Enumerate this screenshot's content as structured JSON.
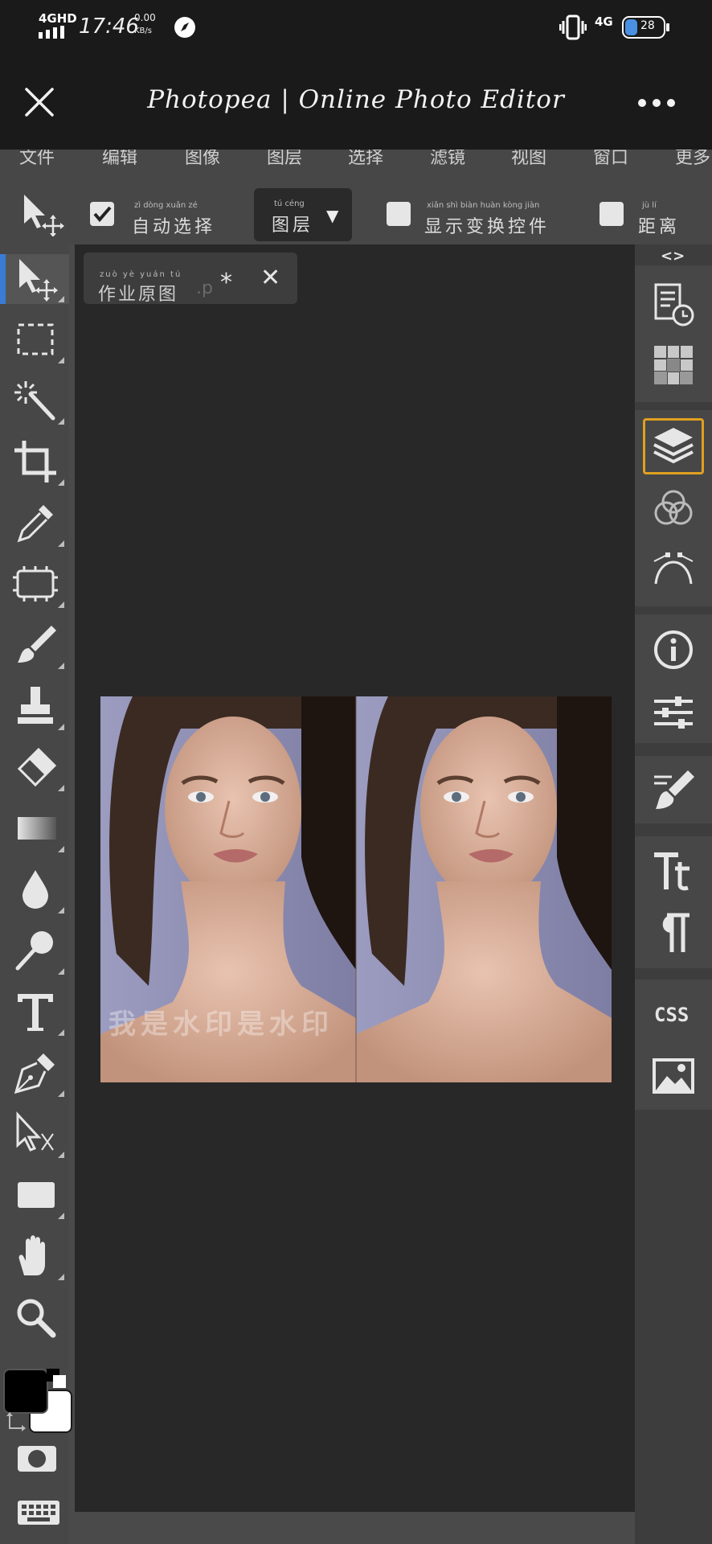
{
  "status_bar": {
    "network": "4GHD",
    "time": "17:46",
    "speed_value": "0.00",
    "speed_unit": "KB/s",
    "network_right": "4G",
    "battery": "28"
  },
  "title_bar": {
    "title": "Photopea | Online Photo Editor"
  },
  "menu": {
    "items": [
      "文件",
      "编辑",
      "图像",
      "图层",
      "选择",
      "滤镜",
      "视图",
      "窗口",
      "更多"
    ]
  },
  "options": {
    "auto_select": {
      "label": "自动选择",
      "pinyin": "zì dòng xuǎn zé",
      "checked": true
    },
    "layer_dropdown": {
      "label": "图层",
      "pinyin": "tú céng",
      "arrow": "▼"
    },
    "show_transform": {
      "label": "显示变换控件",
      "pinyin": "xiǎn shì biàn huàn kòng jiàn",
      "checked": false
    },
    "distance": {
      "label": "距离",
      "pinyin": "jù lí",
      "checked": false
    }
  },
  "document_tab": {
    "name": "作业原图",
    "pinyin": "zuò yè yuán tú",
    "ext_fade": ".p",
    "modified": "*",
    "close": "✕"
  },
  "right_panel": {
    "toggle": "<>",
    "css_label": "CSS"
  },
  "photo": {
    "watermark": "我是水印是水印"
  },
  "colors": {
    "foreground": "#000000",
    "background": "#ffffff",
    "active_panel_border": "#e0a020",
    "active_tool_marker": "#3a7bd5"
  }
}
